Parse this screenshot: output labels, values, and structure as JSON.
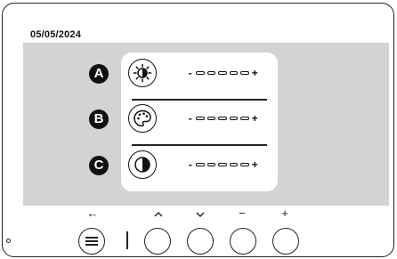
{
  "header": {
    "date": "05/05/2024"
  },
  "settings": {
    "rows": [
      {
        "letter": "A",
        "icon": "brightness-icon",
        "minus": "-",
        "plus": "+"
      },
      {
        "letter": "B",
        "icon": "palette-icon",
        "minus": "-",
        "plus": "+"
      },
      {
        "letter": "C",
        "icon": "contrast-icon",
        "minus": "-",
        "plus": "+"
      }
    ]
  },
  "soft_keys": {
    "back": "←",
    "up": "^",
    "down": "v",
    "minus": "−",
    "plus": "+"
  },
  "colors": {
    "screen_bg": "#d3d3d3",
    "panel_bg": "#ffffff",
    "ink": "#111111"
  }
}
